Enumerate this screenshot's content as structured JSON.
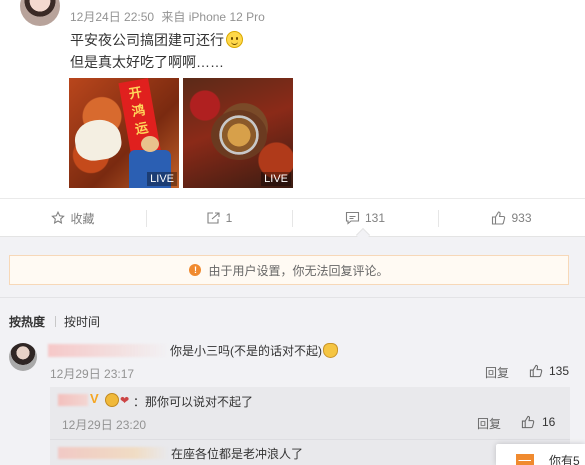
{
  "post": {
    "date": "12月24日 22:50",
    "source": "来自 iPhone 12 Pro",
    "line1": "平安夜公司搞团建可还行",
    "line2": "但是真太好吃了啊啊……",
    "photos": [
      {
        "badge": "LIVE",
        "banner_text": "开鸿运"
      },
      {
        "badge": "LIVE"
      }
    ]
  },
  "actions": {
    "favorite": "收藏",
    "repost": "1",
    "comments": "131",
    "likes": "933"
  },
  "notice": "由于用户设置，你无法回复评论。",
  "sort": {
    "hot": "按热度",
    "time": "按时间"
  },
  "comment": {
    "text": "你是小三吗(不是的话对不起)",
    "time": "12月29日 23:17",
    "reply": "回复",
    "likes": "135"
  },
  "sub_replies": [
    {
      "v_mark": "V",
      "text": "：那你可以说对不起了",
      "time": "12月29日 23:20",
      "reply": "回复",
      "likes": "16"
    },
    {
      "text": "在座各位都是老冲浪人了"
    }
  ],
  "popup": {
    "text": "你有5"
  },
  "colors": {
    "accent_orange": "#f08a2f",
    "muted_text": "#939393",
    "comment_bg": "#f2f2f5"
  }
}
